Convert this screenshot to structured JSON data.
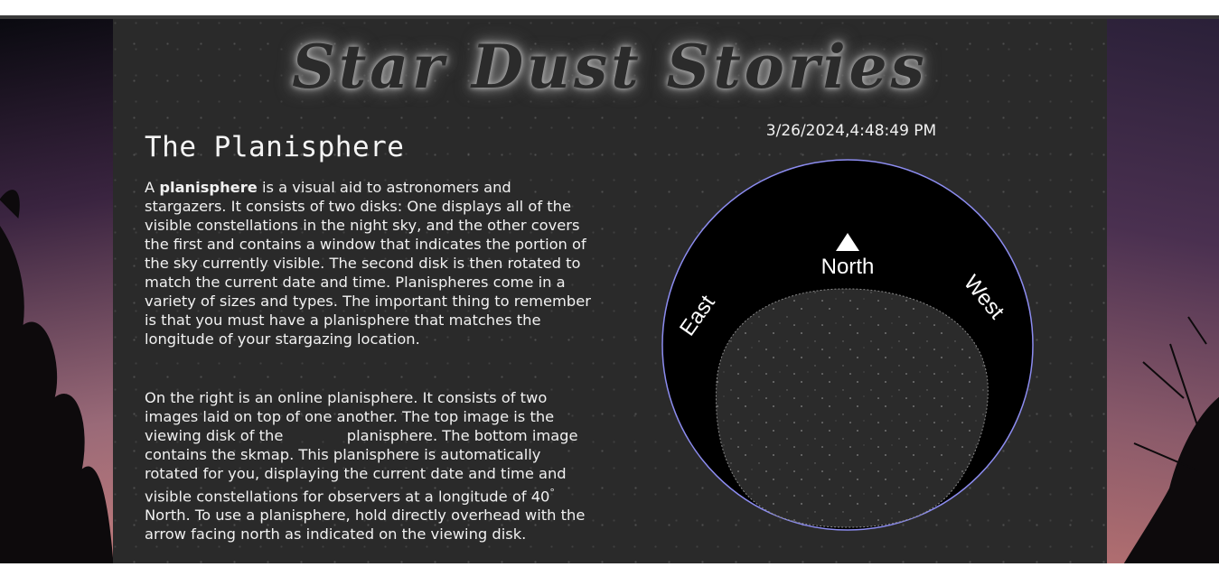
{
  "site": {
    "logo_text": "Star Dust Stories"
  },
  "article": {
    "heading": "The Planisphere",
    "p1_word_a": "A ",
    "p1_bold": "planisphere",
    "p1_rest": " is a visual aid to astronomers and stargazers. It consists of two disks: One displays all of the visible constellations in the night sky, and the other covers the first and contains a window that indicates the portion of the sky currently visible. The second disk is then rotated to match the current date and time. Planispheres come in a variety of sizes and types. The important thing to remember is that you must have a planisphere that matches the longitude of your stargazing location.",
    "p2_start": "On the right is an online planisphere. It consists of two images laid on top of one another. The top image is the viewing disk of the",
    "p2_mid": "planisphere. The bottom image contains the skmap. This planisphere is automatically rotated for you, displaying the current date and time and visible constellations for observers at a longitude of 40",
    "p2_degree": "°",
    "p2_end": " North. To use a planisphere, hold directly overhead with the arrow facing north as indicated on the viewing disk."
  },
  "planisphere": {
    "datetime": "3/26/2024,4:48:49 PM",
    "label_north": "North",
    "label_east": "East",
    "label_west": "West",
    "north_arrow_icon": "triangle-up-icon"
  },
  "colors": {
    "panel_bg": "#2a2a2a",
    "text": "#f1f1f1",
    "disk": "#000000",
    "disk_rim": "#8c8cf0"
  }
}
